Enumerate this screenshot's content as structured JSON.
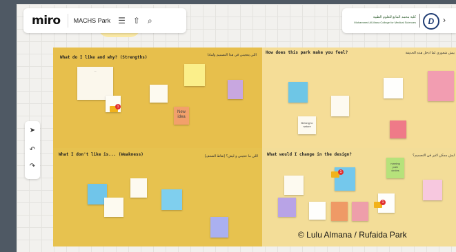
{
  "app": {
    "logo": "miro",
    "board_name": "MACHS Park"
  },
  "toolbar_top": {
    "menu_icon": "☰",
    "upload_icon": "⇧",
    "search_icon": "⌕"
  },
  "branding": {
    "arabic_logo_text": "كلية محمد المانع للعلوم الطبية",
    "english_logo_text": "Mohammed Al-Mana College for Medical Sciences",
    "uni_logo": "D",
    "chevron": "›"
  },
  "side_tools": {
    "cursor": "➤",
    "undo": "↶",
    "redo": "↷"
  },
  "quadrants": {
    "strengths": {
      "title": "What do I like and why? (Strengths)",
      "arabic": "اللي يعجبني في هذا التصميم ولماذا"
    },
    "feel": {
      "title": "How does this park make you feel?",
      "arabic": "بيش شعوري لما ادخل هذه الحديقة"
    },
    "weakness": {
      "title": "What I don't like is... (Weakness)",
      "arabic": "اللي ما عجبني و ليش؟ (نقاط الضعف)"
    },
    "change": {
      "title": "What would I change in the design?",
      "arabic": "ايش ممكن اغير في التصميم؟"
    }
  },
  "notes": {
    "new_idea": "New idea",
    "belong": "Belong to nature",
    "running": "running path circles"
  },
  "copyright": "© Lulu Almana / Rufaida Park",
  "colors": {
    "strength_bg": "#e7bf4c",
    "feel_bg": "#f5dd97",
    "weakness_bg": "#e7c24f",
    "change_bg": "#f3dd98"
  }
}
